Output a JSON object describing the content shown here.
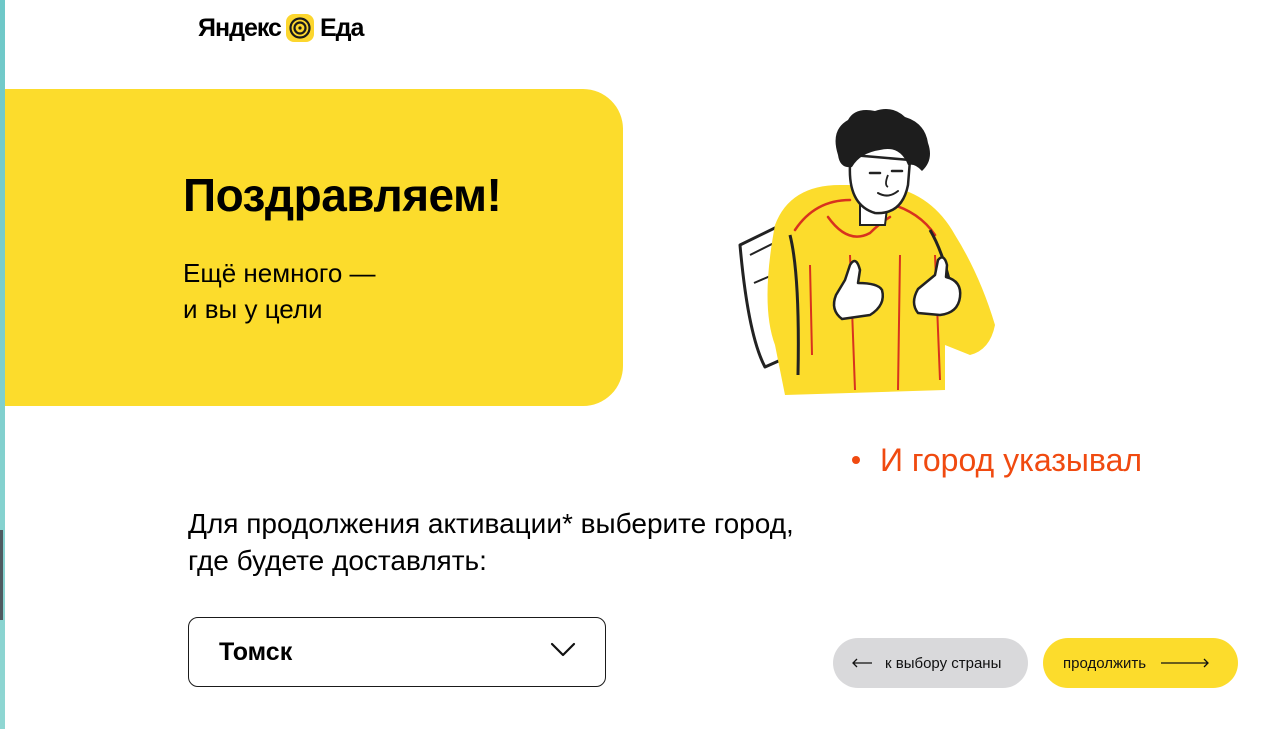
{
  "header": {
    "logo_left": "Яндекс",
    "logo_right": "Еда"
  },
  "hero": {
    "title": "Поздравляем!",
    "subtitle_line1": "Ещё немного —",
    "subtitle_line2": "и вы у цели"
  },
  "note": {
    "text": "И город указывал"
  },
  "form": {
    "prompt_line1": "Для продолжения активации* выберите город,",
    "prompt_line2": "где будете доставлять:",
    "city_select": {
      "selected": "Томск"
    }
  },
  "buttons": {
    "back_label": "к выбору страны",
    "next_label": "продолжить"
  },
  "colors": {
    "brand_yellow": "#fcdc2c",
    "accent_orange": "#f04a10",
    "secondary_button": "#d9d9db"
  },
  "icons": {
    "logo_mark": "yandex-eda-swirl-icon",
    "select_arrow": "chevron-down-icon",
    "back_arrow": "arrow-left-icon",
    "next_arrow": "arrow-right-icon"
  }
}
